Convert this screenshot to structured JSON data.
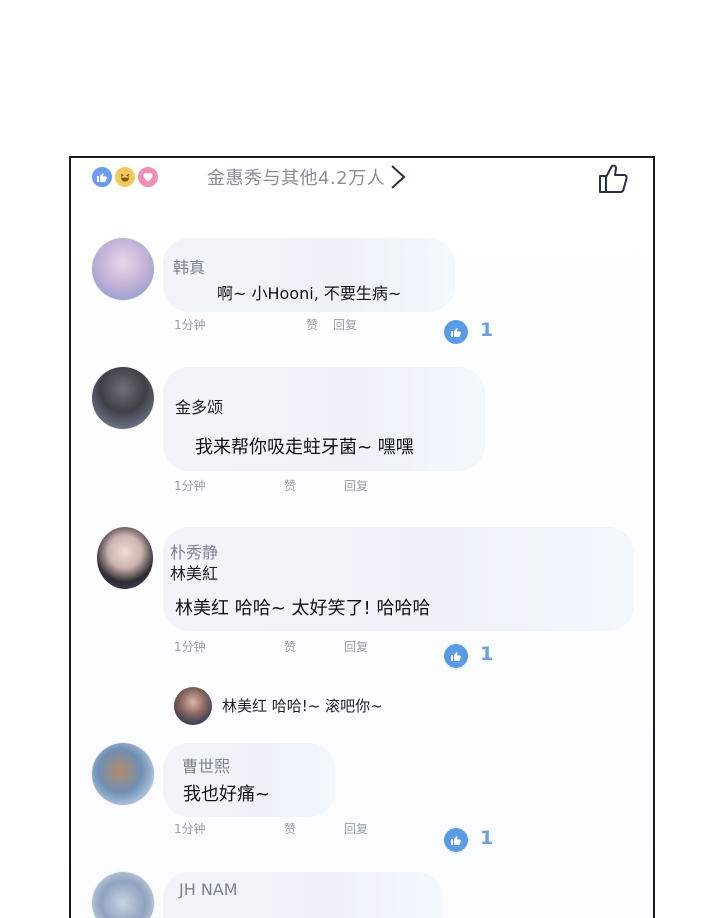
{
  "header": {
    "reaction_icons": [
      "like-icon",
      "haha-icon",
      "love-icon"
    ],
    "summary": "金惠秀与其他4.2万人"
  },
  "comments": [
    {
      "name": "韩真",
      "text": "啊~ 小Hooni, 不要生病~",
      "time": "1分钟",
      "like_label": "赞",
      "reply_label": "回复",
      "likes": "1"
    },
    {
      "name": "金多颂",
      "text": "我来帮你吸走蛀牙菌~ 嘿嘿",
      "time": "1分钟",
      "like_label": "赞",
      "reply_label": "回复"
    },
    {
      "name": "朴秀静",
      "mention": "林美紅",
      "text": "林美红  哈哈~ 太好笑了! 哈哈哈",
      "time": "1分钟",
      "like_label": "赞",
      "reply_label": "回复",
      "likes": "1"
    },
    {
      "name": "曹世熙",
      "text": "我也好痛~",
      "time": "1分钟",
      "like_label": "赞",
      "reply_label": "回复",
      "likes": "1"
    },
    {
      "name": "JH NAM"
    }
  ],
  "reply": {
    "text": "林美红 哈哈!~ 滚吧你~"
  },
  "colors": {
    "accent": "#5b9ae6",
    "bubble": "#eef2f8",
    "border": "#1a1a1a"
  }
}
